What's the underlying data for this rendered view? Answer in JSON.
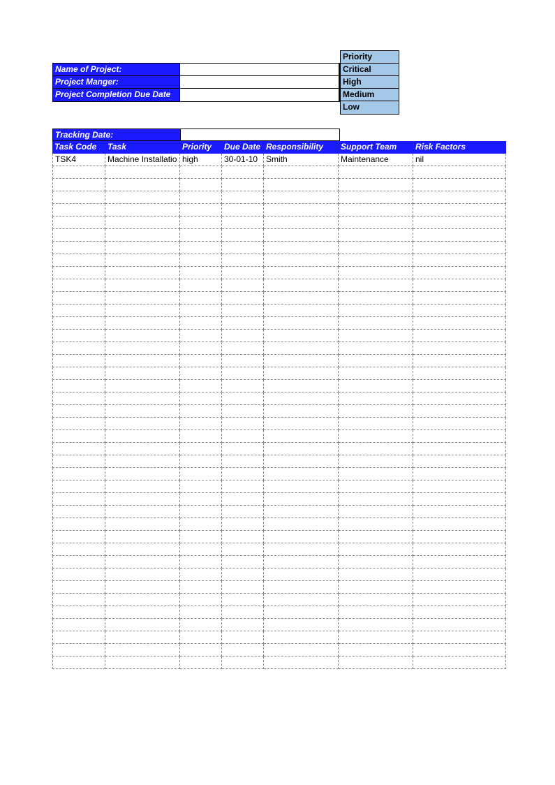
{
  "project_info": {
    "labels": {
      "name": "Name of Project:",
      "manager": "Project Manger:",
      "due_date": "Project Completion Due Date"
    },
    "values": {
      "name": "",
      "manager": "",
      "due_date": ""
    }
  },
  "priority_legend": {
    "header": "Priority",
    "levels": [
      "Critical",
      "High",
      "Medium",
      "Low"
    ]
  },
  "tracking": {
    "label": "Tracking Date:",
    "value": ""
  },
  "table": {
    "headers": {
      "task_code": "Task Code",
      "task": "Task",
      "priority": "Priority",
      "due_date": "Due Date",
      "responsibility": "Responsibility",
      "support_team": "Support Team",
      "risk_factors": "Risk Factors"
    },
    "rows": [
      {
        "task_code": "TSK4",
        "task": "Machine Installatio",
        "priority": "high",
        "due_date": "30-01-10",
        "responsibility": "Smith",
        "support_team": "Maintenance",
        "risk_factors": "nil"
      }
    ],
    "empty_row_count": 40
  },
  "colors": {
    "blue_header": "#1a1aff",
    "light_blue": "#a4c8e8"
  }
}
